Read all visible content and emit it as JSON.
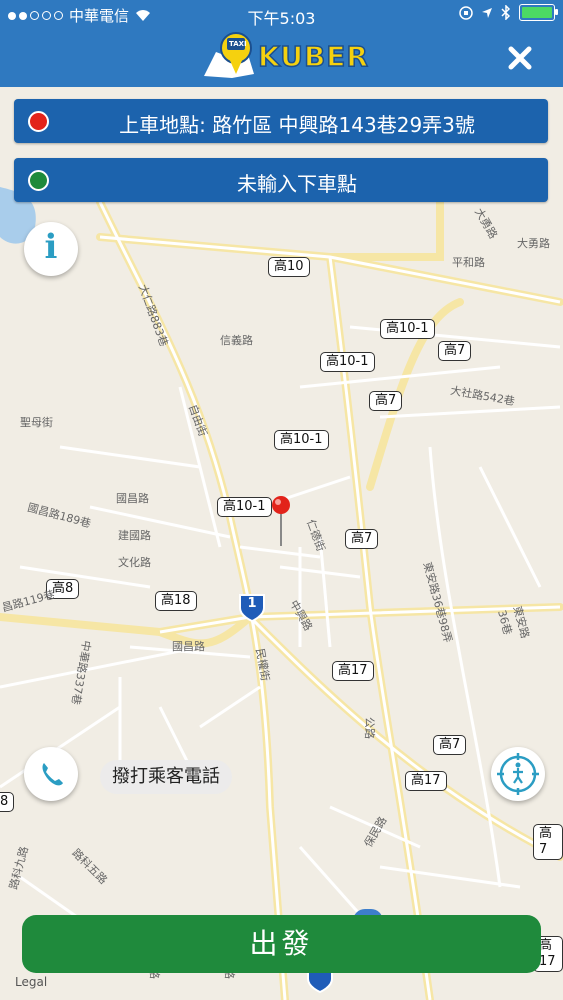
{
  "status_bar": {
    "carrier": "中華電信",
    "time": "下午5:03"
  },
  "header": {
    "logo_text": "KUBER",
    "logo_badge": "TAXI"
  },
  "pickup": {
    "label": "上車地點: 路竹區 中興路143巷29弄3號",
    "pin_color": "#e2231a"
  },
  "dropoff": {
    "label": "未輸入下車點",
    "pin_color": "#1e8a3b"
  },
  "map": {
    "road_labels": [
      "高10",
      "高10-1",
      "高7",
      "高10-1",
      "高7",
      "高10-1",
      "高10-1",
      "高7",
      "高8",
      "高18",
      "高17",
      "高7",
      "高17",
      "高7",
      "8",
      "高17"
    ],
    "shield": "1",
    "streets": [
      "大仁路883巷",
      "信義路",
      "自由街",
      "聖母街",
      "國昌路",
      "國昌路189巷",
      "建國路",
      "文化路",
      "國昌路",
      "中興路",
      "民權街",
      "東安路36巷98弄",
      "東安路36巷",
      "平和路",
      "大勇路",
      "大社路542巷",
      "保民路",
      "路科五路",
      "路科九路",
      "中華路337巷",
      "昌路119巷",
      "五路",
      "三路",
      "大勇路",
      "公路",
      "仁德街"
    ],
    "legal": "Legal"
  },
  "call_button_label": "撥打乘客電話",
  "go_button_label": "出發",
  "colors": {
    "header_blue": "#2f79c0",
    "bar_blue": "#1c63ad",
    "go_green": "#1f8a3c"
  }
}
